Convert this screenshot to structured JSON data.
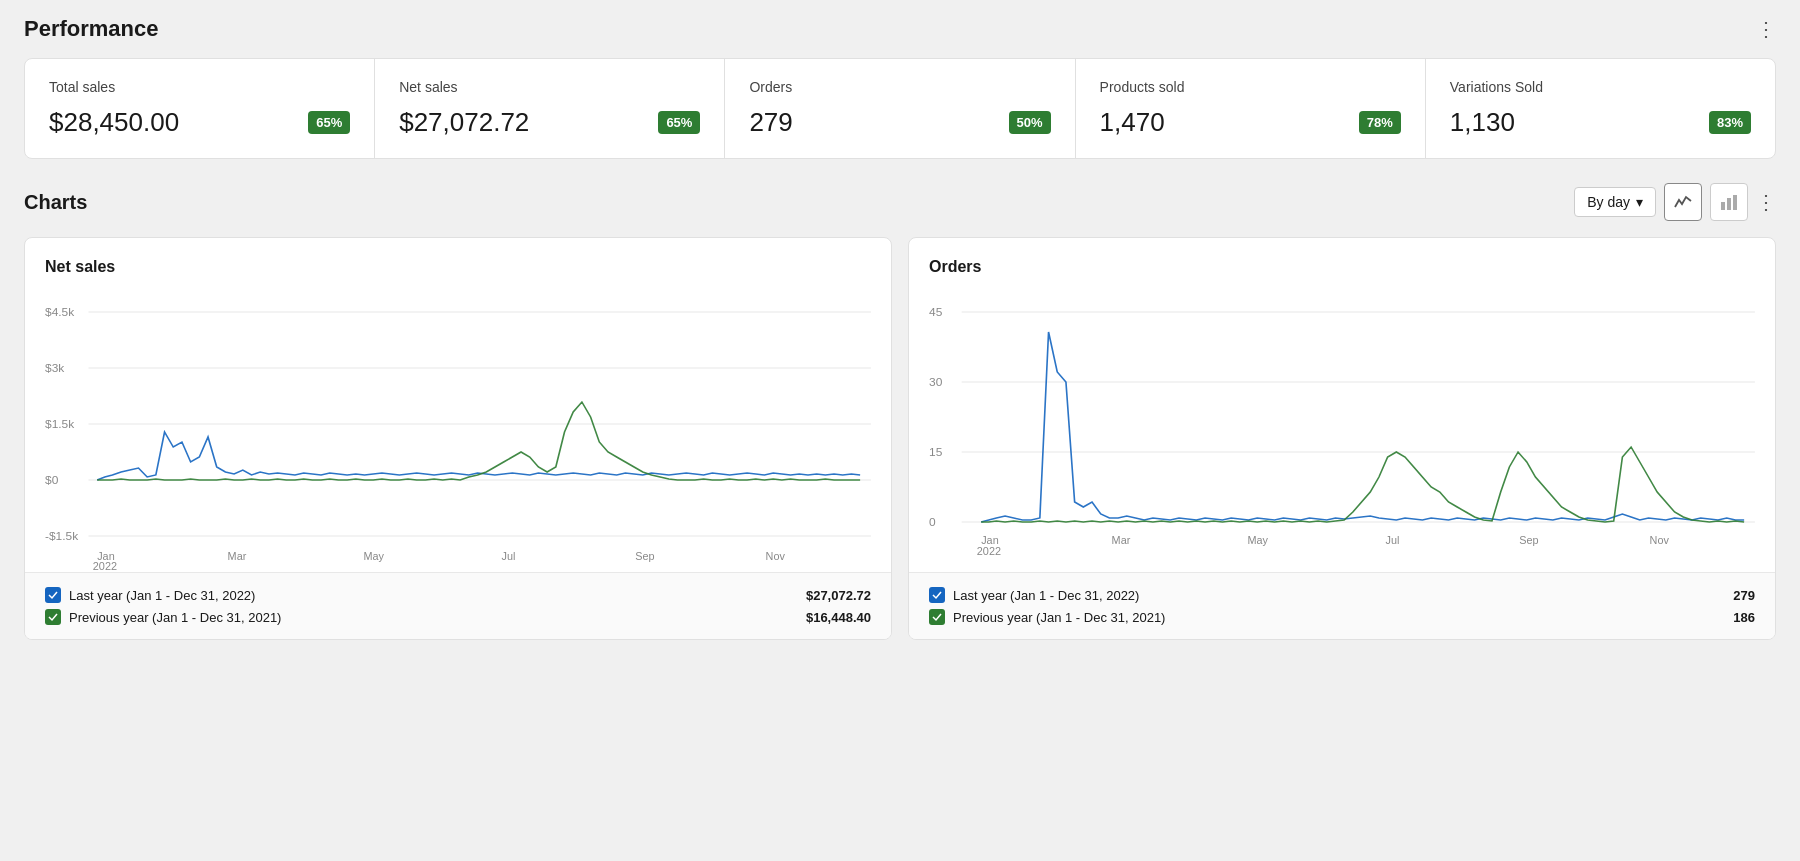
{
  "page": {
    "title": "Performance",
    "more_label": "⋮"
  },
  "kpi_cards": [
    {
      "label": "Total sales",
      "value": "$28,450.00",
      "badge": "65%",
      "id": "total-sales"
    },
    {
      "label": "Net sales",
      "value": "$27,072.72",
      "badge": "65%",
      "id": "net-sales"
    },
    {
      "label": "Orders",
      "value": "279",
      "badge": "50%",
      "id": "orders"
    },
    {
      "label": "Products sold",
      "value": "1,470",
      "badge": "78%",
      "id": "products-sold"
    },
    {
      "label": "Variations Sold",
      "value": "1,130",
      "badge": "83%",
      "id": "variations-sold"
    }
  ],
  "charts_section": {
    "title": "Charts",
    "more_label": "⋮",
    "period_selector": {
      "label": "By day",
      "chevron": "▾"
    },
    "chart_type_icon": "〜"
  },
  "net_sales_chart": {
    "title": "Net sales",
    "y_labels": [
      "$4.5k",
      "$3k",
      "$1.5k",
      "$0",
      "-$1.5k"
    ],
    "x_labels": [
      "Jan\n2022",
      "Mar",
      "May",
      "Jul",
      "Sep",
      "Nov"
    ],
    "legend": [
      {
        "label": "Last year (Jan 1 - Dec 31, 2022)",
        "value": "$27,072.72",
        "color": "blue"
      },
      {
        "label": "Previous year (Jan 1 - Dec 31, 2021)",
        "value": "$16,448.40",
        "color": "green"
      }
    ]
  },
  "orders_chart": {
    "title": "Orders",
    "y_labels": [
      "45",
      "30",
      "15",
      "0"
    ],
    "x_labels": [
      "Jan\n2022",
      "Mar",
      "May",
      "Jul",
      "Sep",
      "Nov"
    ],
    "legend": [
      {
        "label": "Last year (Jan 1 - Dec 31, 2022)",
        "value": "279",
        "color": "blue"
      },
      {
        "label": "Previous year (Jan 1 - Dec 31, 2021)",
        "value": "186",
        "color": "green"
      }
    ]
  }
}
